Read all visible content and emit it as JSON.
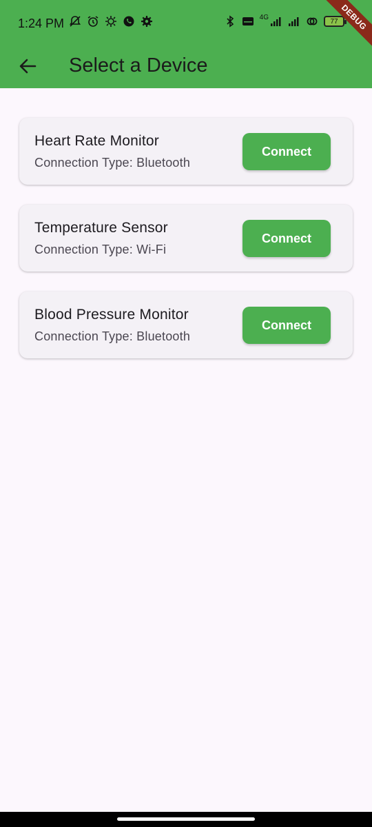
{
  "status_bar": {
    "time": "1:24 PM",
    "battery": "77",
    "network": "4G",
    "icons_left": [
      "muted-bell-icon",
      "alarm-icon",
      "settings-sun-icon",
      "whatsapp-icon",
      "gear-icon"
    ],
    "icons_right": [
      "bluetooth-icon",
      "volte-icon",
      "signal-icon",
      "signal-icon",
      "link-icon",
      "battery-icon"
    ]
  },
  "debug_banner": "DEBUG",
  "app_bar": {
    "title": "Select a Device",
    "back_icon": "arrow-back-icon"
  },
  "devices": [
    {
      "name": "Heart Rate Monitor",
      "connection": "Connection Type: Bluetooth",
      "button": "Connect"
    },
    {
      "name": "Temperature Sensor",
      "connection": "Connection Type: Wi-Fi",
      "button": "Connect"
    },
    {
      "name": "Blood Pressure Monitor",
      "connection": "Connection Type: Bluetooth",
      "button": "Connect"
    }
  ],
  "colors": {
    "primary": "#4caf50",
    "background": "#fcf7fd",
    "card": "#f4f1f6"
  }
}
